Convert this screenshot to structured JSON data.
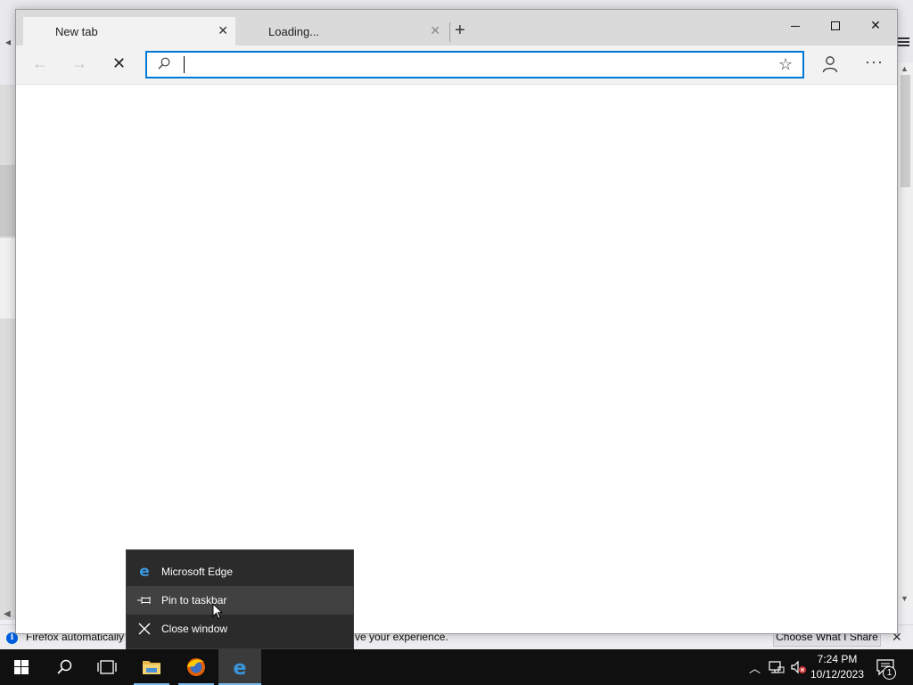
{
  "firefox": {
    "notification_text_left": "Firefox automatically",
    "notification_text_right": "ve your experience.",
    "notification_button": "Choose What I Share",
    "notification_close": "✕"
  },
  "edge": {
    "tabs": [
      {
        "label": "New tab",
        "active": true
      },
      {
        "label": "Loading...",
        "active": false
      }
    ],
    "tab_close_glyph": "✕",
    "new_tab_glyph": "+",
    "window_close_glyph": "✕",
    "nav": {
      "back": "←",
      "forward": "→",
      "stop": "✕"
    },
    "address_bar": {
      "value": "",
      "placeholder": ""
    },
    "favorite_glyph": "☆",
    "more_glyph": "···"
  },
  "jump_list": {
    "items": [
      {
        "label": "Microsoft Edge",
        "icon": "edge-icon"
      },
      {
        "label": "Pin to taskbar",
        "icon": "pin-icon"
      },
      {
        "label": "Close window",
        "icon": "close-icon"
      }
    ]
  },
  "taskbar": {
    "time": "7:24 PM",
    "date": "10/12/2023",
    "notification_count": "1",
    "apps": [
      "start",
      "search",
      "task-view",
      "file-explorer",
      "firefox",
      "edge"
    ]
  },
  "colors": {
    "accent": "#0078d7",
    "taskbar": "#101010",
    "menu_bg": "#2b2b2b",
    "menu_hover": "#414141"
  }
}
